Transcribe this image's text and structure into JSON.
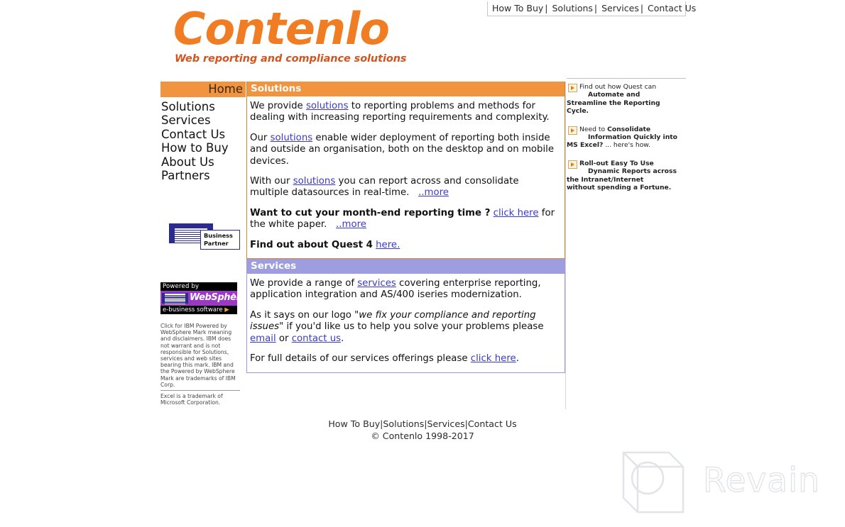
{
  "topnav": {
    "items": [
      "How To Buy",
      "Solutions",
      "Services",
      "Contact Us"
    ],
    "separator": "|"
  },
  "brand": {
    "logo": "Contenlo",
    "tagline": "Web reporting and compliance solutions"
  },
  "sidebar": {
    "active": "Home",
    "items": [
      "Solutions",
      "Services",
      "Contact Us",
      "How to Buy",
      "About Us",
      "Partners"
    ],
    "ibm_logo": {
      "mark": "IBM",
      "line1": "Business",
      "line2": "Partner"
    },
    "websphere_badge": {
      "top": "Powered by",
      "mark": "IBM",
      "name": "WebSphere",
      "star": "*",
      "bottom": "e-business software",
      "triangle": "▶"
    },
    "disclaimer": "Click for IBM Powered by WebSphere Mark meaning and disclaimers. IBM does not warrant and is not responsible for Solutions, services and web sites bearing this mark. IBM and the Powered by WebSphere Mark are trademarks of IBM Corp.",
    "disclaimer2": "Excel is a trademark of Microsoft Corporation."
  },
  "solutions": {
    "title": "Solutions",
    "p1_a": "We provide ",
    "p1_link": "solutions",
    "p1_b": " to reporting problems and methods for dealing with increasing reporting requirements and complexity.",
    "p2_a": "Our ",
    "p2_link": "solutions",
    "p2_b": " enable wider deployment of reporting both inside and outside an organisation, both on the desktop and on mobile devices.",
    "p3_a": "With our ",
    "p3_link": "solutions",
    "p3_b": " you can report across and consolidate multiple datasources in real-time.",
    "p3_more": "..more",
    "p4_bold": "Want to cut your month-end reporting time ?",
    "p4_link": "click here",
    "p4_tail": " for the white paper.",
    "p4_more": "..more",
    "p5_bold": "Find out about Quest 4",
    "p5_link": "here."
  },
  "services": {
    "title": "Services",
    "p1_a": "We provide a range of ",
    "p1_link": "services",
    "p1_b": " covering enterprise reporting, application integration and AS/400 iseries modernization.",
    "p2_a": "As it says on our logo ",
    "p2_quote": "\"we fix your compliance and reporting issues\"",
    "p2_b": " if you'd like us to help you solve your problems please ",
    "p2_link1": "email",
    "p2_mid": " or ",
    "p2_link2": "contact us",
    "p2_end": ".",
    "p3_a": "For full details of our services offerings please ",
    "p3_link": "click here",
    "p3_end": "."
  },
  "promos": [
    {
      "icon": "arrow-play-icon",
      "line1": "Find out how Quest can",
      "line2_bold": "Automate and",
      "line3_bold": "Streamline the Reporting",
      "line4_bold": "Cycle."
    },
    {
      "icon": "arrow-play-icon",
      "line1": "Need to ",
      "line1_bold": "Consolidate",
      "line2_bold": "Information Quickly into",
      "line3_bold": "MS Excel?",
      "line3_tail": " ... here's how."
    },
    {
      "icon": "arrow-play-icon",
      "line1_bold": "Roll-out Easy To Use",
      "line2_bold": "Dynamic Reports across",
      "line3_bold": "the Intranet/Internet",
      "line4_bold": "without spending a Fortune."
    }
  ],
  "footer": {
    "items": [
      "How To Buy",
      "Solutions",
      "Services",
      "Contact Us"
    ],
    "separator": "|",
    "copyright": "© Contenlo 1998-2017"
  },
  "watermark": {
    "text": "Revain",
    "logo": "revain-logo-icon",
    "color": "#E2E4E7"
  }
}
